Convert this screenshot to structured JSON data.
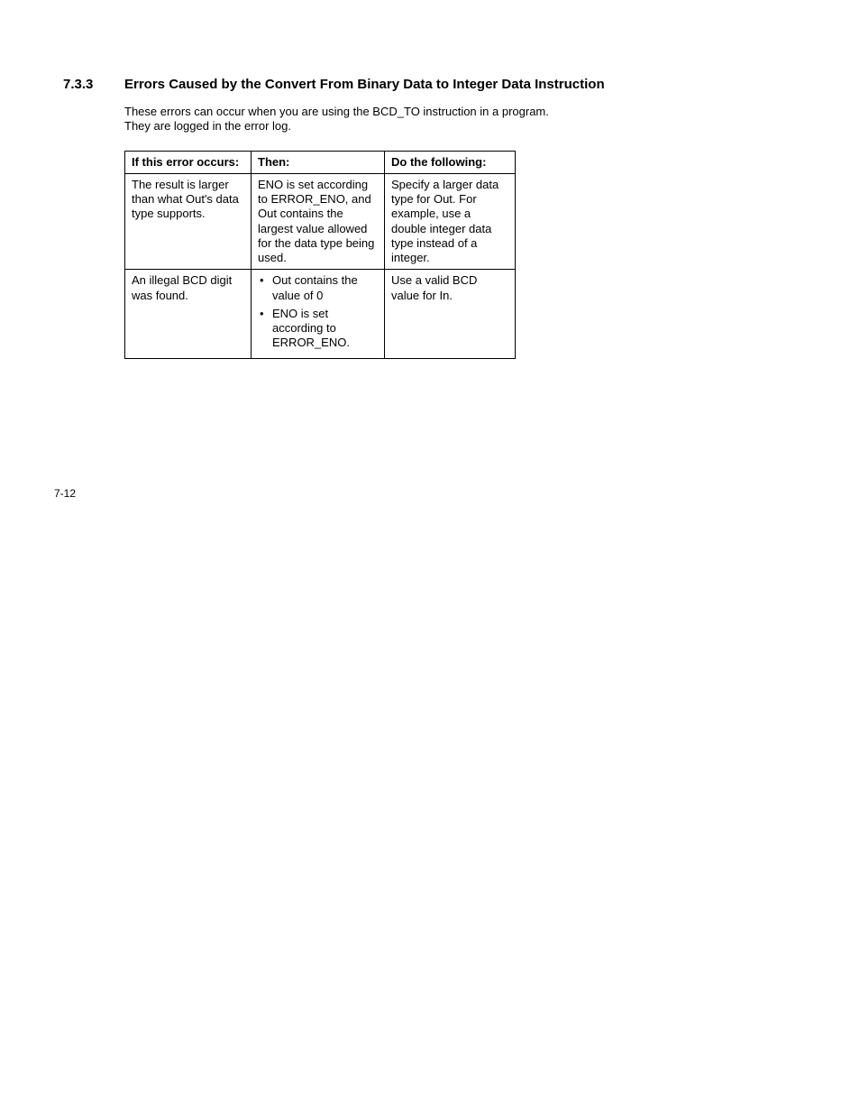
{
  "section_number": "7.3.3",
  "section_title": "Errors Caused by the Convert From Binary Data to Integer Data Instruction",
  "intro_text": "These errors can occur when you are using the BCD_TO instruction in a program. They are logged in the error log.",
  "table": {
    "headers": [
      "If this error occurs:",
      "Then:",
      "Do the following:"
    ],
    "rows": [
      {
        "error": "The result is larger than what Out's data type supports.",
        "then_text": "ENO is set according to ERROR_ENO, and Out contains the largest value allowed for the data type being used.",
        "action": "Specify a larger data type for Out. For example, use a double integer data type instead of a integer."
      },
      {
        "error": "An illegal BCD digit was found.",
        "then_bullets": [
          "Out contains the value of 0",
          "ENO is set according to ERROR_ENO."
        ],
        "action": "Use a valid BCD value for In."
      }
    ]
  },
  "page_number": "7-12"
}
